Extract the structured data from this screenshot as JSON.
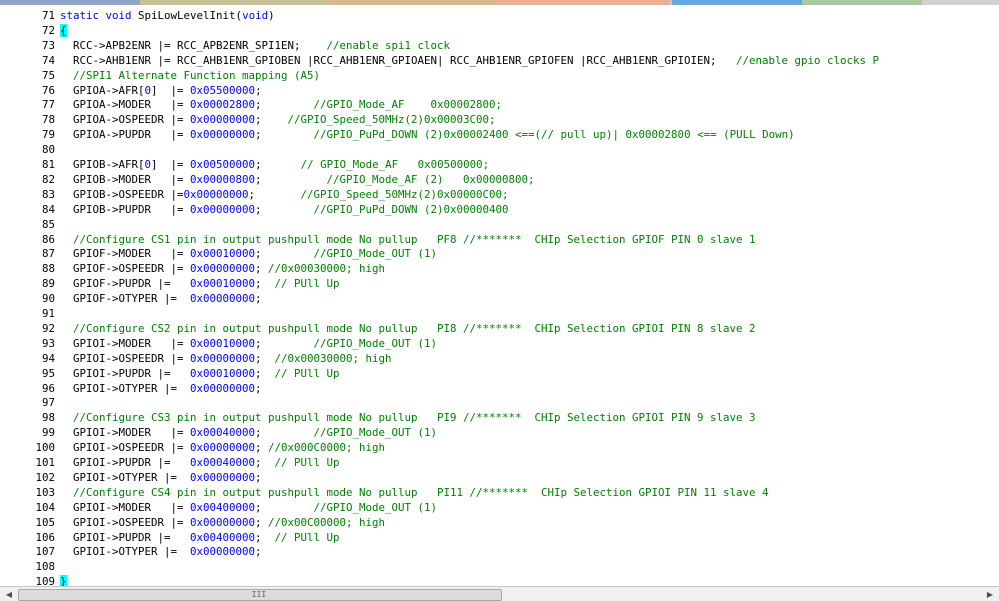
{
  "colors": {
    "keyword": "#0000ff",
    "comment": "#008000",
    "number": "#0000ff",
    "text": "#000000",
    "brace_highlight": "#00ffff",
    "tab_colors": [
      "#8fa6c8",
      "#c9c098",
      "#d8b98c",
      "#e8b090",
      "#c8c8c8",
      "#6aa6d8",
      "#a8c8a0",
      "#d0d0d0"
    ]
  },
  "scrollbar": {
    "left_icon": "arrow-left-icon",
    "right_icon": "arrow-right-icon",
    "left_glyph": "◀",
    "right_glyph": "▶",
    "grip": "III"
  },
  "lines": [
    {
      "n": "71",
      "segs": [
        [
          "kw",
          "static"
        ],
        [
          "tx",
          " "
        ],
        [
          "kw",
          "void"
        ],
        [
          "tx",
          " SpiLowLevelInit("
        ],
        [
          "kw",
          "void"
        ],
        [
          "tx",
          ")"
        ]
      ]
    },
    {
      "n": "72",
      "segs": [
        [
          "brace",
          "{"
        ]
      ]
    },
    {
      "n": "73",
      "segs": [
        [
          "tx",
          "  RCC->APB2ENR |= RCC_APB2ENR_SPI1EN;    "
        ],
        [
          "cm",
          "//enable spi1 clock"
        ]
      ]
    },
    {
      "n": "74",
      "segs": [
        [
          "tx",
          "  RCC->AHB1ENR |= RCC_AHB1ENR_GPIOBEN |RCC_AHB1ENR_GPIOAEN| RCC_AHB1ENR_GPIOFEN |RCC_AHB1ENR_GPIOIEN;   "
        ],
        [
          "cm",
          "//enable gpio clocks P"
        ]
      ]
    },
    {
      "n": "75",
      "segs": [
        [
          "cm",
          "  //SPI1 Alternate Function mapping (A5)"
        ]
      ]
    },
    {
      "n": "76",
      "segs": [
        [
          "tx",
          "  GPIOA->AFR["
        ],
        [
          "num",
          "0"
        ],
        [
          "tx",
          "]  |= "
        ],
        [
          "num",
          "0x05500000"
        ],
        [
          "tx",
          ";"
        ]
      ]
    },
    {
      "n": "77",
      "segs": [
        [
          "tx",
          "  GPIOA->MODER   |= "
        ],
        [
          "num",
          "0x00002800"
        ],
        [
          "tx",
          ";        "
        ],
        [
          "cm",
          "//GPIO_Mode_AF    0x00002800;"
        ]
      ]
    },
    {
      "n": "78",
      "segs": [
        [
          "tx",
          "  GPIOA->OSPEEDR |= "
        ],
        [
          "num",
          "0x00000000"
        ],
        [
          "tx",
          ";    "
        ],
        [
          "cm",
          "//GPIO_Speed_50MHz(2)0x00003C00;"
        ]
      ]
    },
    {
      "n": "79",
      "segs": [
        [
          "tx",
          "  GPIOA->PUPDR   |= "
        ],
        [
          "num",
          "0x00000000"
        ],
        [
          "tx",
          ";        "
        ],
        [
          "cm",
          "//GPIO_PuPd_DOWN (2)0x00002400 <==(// pull up)| 0x00002800 <== (PULL Down)"
        ]
      ]
    },
    {
      "n": "80",
      "segs": []
    },
    {
      "n": "81",
      "segs": [
        [
          "tx",
          "  GPIOB->AFR["
        ],
        [
          "num",
          "0"
        ],
        [
          "tx",
          "]  |= "
        ],
        [
          "num",
          "0x00500000"
        ],
        [
          "tx",
          ";      "
        ],
        [
          "cm",
          "// GPIO_Mode_AF   0x00500000;"
        ]
      ]
    },
    {
      "n": "82",
      "segs": [
        [
          "tx",
          "  GPIOB->MODER   |= "
        ],
        [
          "num",
          "0x00000800"
        ],
        [
          "tx",
          ";          "
        ],
        [
          "cm",
          "//GPIO_Mode_AF (2)   0x00000800;"
        ]
      ]
    },
    {
      "n": "83",
      "segs": [
        [
          "tx",
          "  GPIOB->OSPEEDR |="
        ],
        [
          "num",
          "0x00000000"
        ],
        [
          "tx",
          ";       "
        ],
        [
          "cm",
          "//GPIO_Speed_50MHz(2)0x00000C00;"
        ]
      ]
    },
    {
      "n": "84",
      "segs": [
        [
          "tx",
          "  GPIOB->PUPDR   |= "
        ],
        [
          "num",
          "0x00000000"
        ],
        [
          "tx",
          ";        "
        ],
        [
          "cm",
          "//GPIO_PuPd_DOWN (2)0x00000400"
        ]
      ]
    },
    {
      "n": "85",
      "segs": []
    },
    {
      "n": "86",
      "segs": [
        [
          "cm",
          "  //Configure CS1 pin in output pushpull mode No pullup   PF8 //*******  CHIp Selection GPIOF PIN 0 slave 1"
        ]
      ]
    },
    {
      "n": "87",
      "segs": [
        [
          "tx",
          "  GPIOF->MODER   |= "
        ],
        [
          "num",
          "0x00010000"
        ],
        [
          "tx",
          ";        "
        ],
        [
          "cm",
          "//GPIO_Mode_OUT (1)"
        ]
      ]
    },
    {
      "n": "88",
      "segs": [
        [
          "tx",
          "  GPIOF->OSPEEDR |= "
        ],
        [
          "num",
          "0x00000000"
        ],
        [
          "tx",
          "; "
        ],
        [
          "cm",
          "//0x00030000; high"
        ]
      ]
    },
    {
      "n": "89",
      "segs": [
        [
          "tx",
          "  GPIOF->PUPDR |=   "
        ],
        [
          "num",
          "0x00010000"
        ],
        [
          "tx",
          ";  "
        ],
        [
          "cm",
          "// PUll Up"
        ]
      ]
    },
    {
      "n": "90",
      "segs": [
        [
          "tx",
          "  GPIOF->OTYPER |=  "
        ],
        [
          "num",
          "0x00000000"
        ],
        [
          "tx",
          ";"
        ]
      ]
    },
    {
      "n": "91",
      "segs": []
    },
    {
      "n": "92",
      "segs": [
        [
          "cm",
          "  //Configure CS2 pin in output pushpull mode No pullup   PI8 //*******  CHIp Selection GPIOI PIN 8 slave 2"
        ]
      ]
    },
    {
      "n": "93",
      "segs": [
        [
          "tx",
          "  GPIOI->MODER   |= "
        ],
        [
          "num",
          "0x00010000"
        ],
        [
          "tx",
          ";        "
        ],
        [
          "cm",
          "//GPIO_Mode_OUT (1)"
        ]
      ]
    },
    {
      "n": "94",
      "segs": [
        [
          "tx",
          "  GPIOI->OSPEEDR |= "
        ],
        [
          "num",
          "0x00000000"
        ],
        [
          "tx",
          ";  "
        ],
        [
          "cm",
          "//0x00030000; high"
        ]
      ]
    },
    {
      "n": "95",
      "segs": [
        [
          "tx",
          "  GPIOI->PUPDR |=   "
        ],
        [
          "num",
          "0x00010000"
        ],
        [
          "tx",
          ";  "
        ],
        [
          "cm",
          "// PUll Up"
        ]
      ]
    },
    {
      "n": "96",
      "segs": [
        [
          "tx",
          "  GPIOI->OTYPER |=  "
        ],
        [
          "num",
          "0x00000000"
        ],
        [
          "tx",
          ";"
        ]
      ]
    },
    {
      "n": "97",
      "segs": []
    },
    {
      "n": "98",
      "segs": [
        [
          "cm",
          "  //Configure CS3 pin in output pushpull mode No pullup   PI9 //*******  CHIp Selection GPIOI PIN 9 slave 3"
        ]
      ]
    },
    {
      "n": "99",
      "segs": [
        [
          "tx",
          "  GPIOI->MODER   |= "
        ],
        [
          "num",
          "0x00040000"
        ],
        [
          "tx",
          ";        "
        ],
        [
          "cm",
          "//GPIO_Mode_OUT (1)"
        ]
      ]
    },
    {
      "n": "100",
      "segs": [
        [
          "tx",
          "  GPIOI->OSPEEDR |= "
        ],
        [
          "num",
          "0x00000000"
        ],
        [
          "tx",
          "; "
        ],
        [
          "cm",
          "//0x000C0000; high"
        ]
      ]
    },
    {
      "n": "101",
      "segs": [
        [
          "tx",
          "  GPIOI->PUPDR |=   "
        ],
        [
          "num",
          "0x00040000"
        ],
        [
          "tx",
          ";  "
        ],
        [
          "cm",
          "// PUll Up"
        ]
      ]
    },
    {
      "n": "102",
      "segs": [
        [
          "tx",
          "  GPIOI->OTYPER |=  "
        ],
        [
          "num",
          "0x00000000"
        ],
        [
          "tx",
          ";"
        ]
      ]
    },
    {
      "n": "103",
      "segs": [
        [
          "cm",
          "  //Configure CS4 pin in output pushpull mode No pullup   PI11 //*******  CHIp Selection GPIOI PIN 11 slave 4"
        ]
      ]
    },
    {
      "n": "104",
      "segs": [
        [
          "tx",
          "  GPIOI->MODER   |= "
        ],
        [
          "num",
          "0x00400000"
        ],
        [
          "tx",
          ";        "
        ],
        [
          "cm",
          "//GPIO_Mode_OUT (1)"
        ]
      ]
    },
    {
      "n": "105",
      "segs": [
        [
          "tx",
          "  GPIOI->OSPEEDR |= "
        ],
        [
          "num",
          "0x00000000"
        ],
        [
          "tx",
          "; "
        ],
        [
          "cm",
          "//0x00C00000; high"
        ]
      ]
    },
    {
      "n": "106",
      "segs": [
        [
          "tx",
          "  GPIOI->PUPDR |=   "
        ],
        [
          "num",
          "0x00400000"
        ],
        [
          "tx",
          ";  "
        ],
        [
          "cm",
          "// PUll Up"
        ]
      ]
    },
    {
      "n": "107",
      "segs": [
        [
          "tx",
          "  GPIOI->OTYPER |=  "
        ],
        [
          "num",
          "0x00000000"
        ],
        [
          "tx",
          ";"
        ]
      ]
    },
    {
      "n": "108",
      "segs": []
    },
    {
      "n": "109",
      "segs": [
        [
          "brace",
          "}"
        ]
      ]
    }
  ]
}
